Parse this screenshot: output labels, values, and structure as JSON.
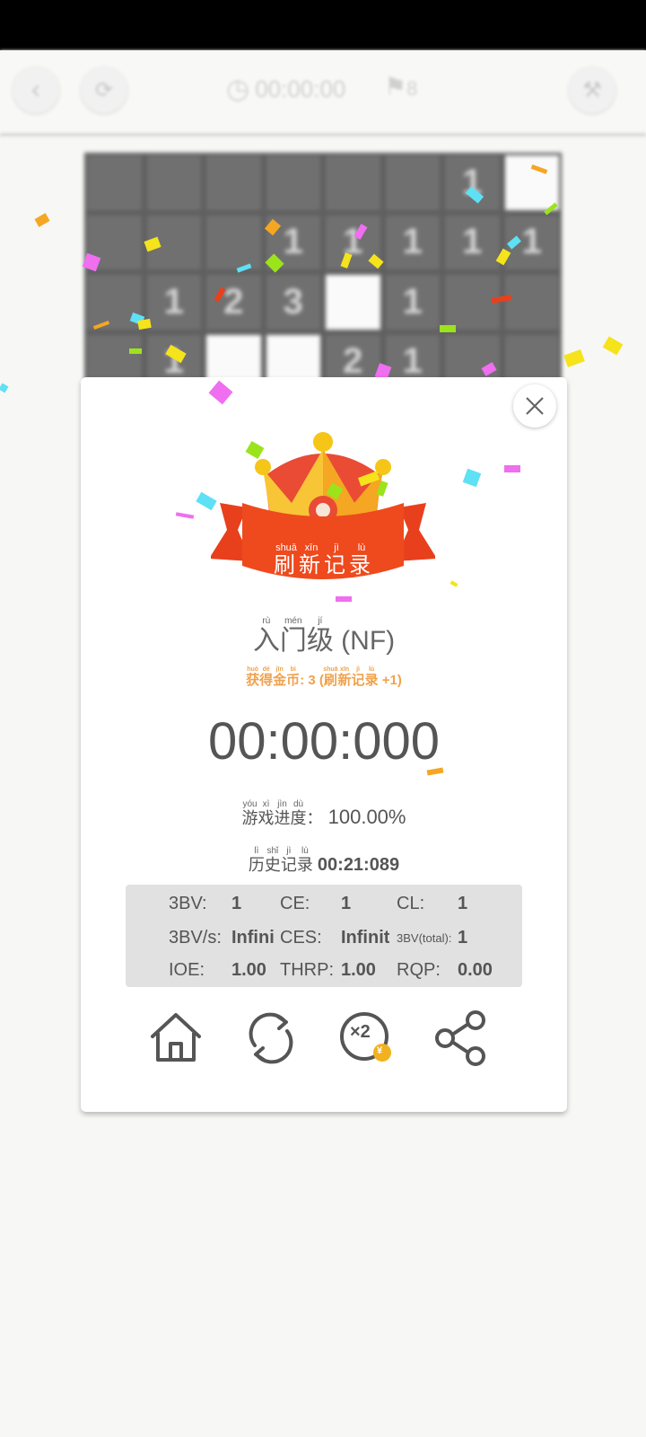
{
  "header": {
    "timer": "00:00:00",
    "flags": "8"
  },
  "board": {
    "cells": [
      "",
      "",
      "",
      "",
      "",
      "",
      "1",
      "#",
      "",
      "",
      "",
      "1",
      "1",
      "1",
      "1",
      "1",
      "",
      "1",
      "2",
      "3",
      "#",
      "1",
      "",
      "",
      "",
      "1",
      "#",
      "#",
      "2",
      "1",
      "",
      ""
    ]
  },
  "dialog": {
    "banner": {
      "title": [
        {
          "ch": "刷",
          "py": "shuā"
        },
        {
          "ch": "新",
          "py": "xīn"
        },
        {
          "ch": "记",
          "py": "jì"
        },
        {
          "ch": "录",
          "py": "lù"
        }
      ]
    },
    "level": {
      "chars": [
        {
          "ch": "入",
          "py": "rù"
        },
        {
          "ch": "门",
          "py": "mén"
        },
        {
          "ch": "级",
          "py": "jí"
        }
      ],
      "suffix": "(NF)"
    },
    "reward": {
      "chars": [
        {
          "ch": "获",
          "py": "huò"
        },
        {
          "ch": "得",
          "py": "dé"
        },
        {
          "ch": "金",
          "py": "jīn"
        },
        {
          "ch": "币",
          "py": "bì"
        }
      ],
      "amount": ": 3 (",
      "note_chars": [
        {
          "ch": "刷",
          "py": "shuā"
        },
        {
          "ch": "新",
          "py": "xīn"
        },
        {
          "ch": "记",
          "py": "jì"
        },
        {
          "ch": "录",
          "py": "lù"
        }
      ],
      "bonus": " +1)"
    },
    "time": "00:00:000",
    "progress": {
      "chars": [
        {
          "ch": "游",
          "py": "yóu"
        },
        {
          "ch": "戏",
          "py": "xì"
        },
        {
          "ch": "进",
          "py": "jìn"
        },
        {
          "ch": "度",
          "py": "dù"
        }
      ],
      "sep": "：",
      "value": "100.00%"
    },
    "history": {
      "chars": [
        {
          "ch": "历",
          "py": "lì"
        },
        {
          "ch": "史",
          "py": "shǐ"
        },
        {
          "ch": "记",
          "py": "jì"
        },
        {
          "ch": "录",
          "py": "lù"
        }
      ],
      "value": "00:21:089"
    },
    "stats": {
      "bv_label": "3BV:",
      "bv": "1",
      "ce_label": "CE:",
      "ce": "1",
      "cl_label": "CL:",
      "cl": "1",
      "bvs_label": "3BV/s:",
      "bvs": "Infini",
      "ces_label": "CES:",
      "ces": "Infinit",
      "bvt_label": "3BV(total):",
      "bvt": "1",
      "ioe_label": "IOE:",
      "ioe": "1.00",
      "thrp_label": "THRP:",
      "thrp": "1.00",
      "rqp_label": "RQP:",
      "rqp": "0.00"
    },
    "actions": {
      "double_label": "×2",
      "coin_symbol": "¥"
    }
  },
  "colors": {
    "accent_orange": "#f0a24d",
    "ribbon_red": "#e8401c",
    "crown_yellow": "#f7c535",
    "crown_orange": "#f5a623",
    "panel_grey": "#e1e1e1"
  }
}
